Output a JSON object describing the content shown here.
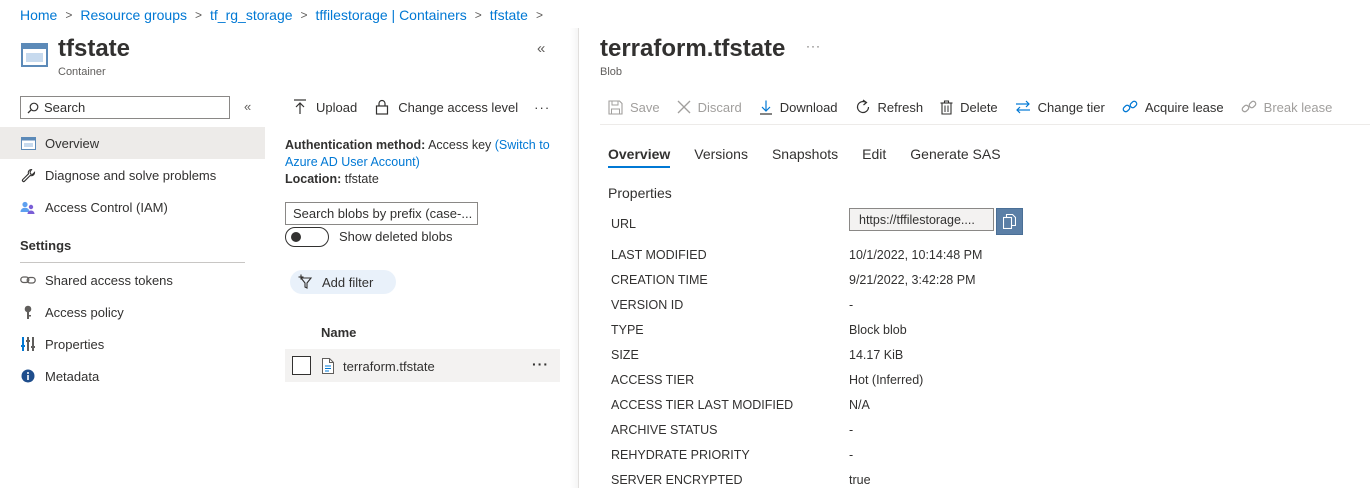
{
  "breadcrumb": [
    "Home",
    "Resource groups",
    "tf_rg_storage",
    "tffilestorage | Containers",
    "tfstate"
  ],
  "container": {
    "title": "tfstate",
    "subtitle": "Container"
  },
  "search": {
    "placeholder": "Search"
  },
  "nav": {
    "items": [
      {
        "label": "Overview",
        "icon": "container-icon",
        "active": true
      },
      {
        "label": "Diagnose and solve problems",
        "icon": "wrench-icon"
      },
      {
        "label": "Access Control (IAM)",
        "icon": "people-icon"
      }
    ],
    "settings_heading": "Settings",
    "settings_items": [
      {
        "label": "Shared access tokens",
        "icon": "link-icon"
      },
      {
        "label": "Access policy",
        "icon": "key-icon"
      },
      {
        "label": "Properties",
        "icon": "sliders-icon"
      },
      {
        "label": "Metadata",
        "icon": "info-icon"
      }
    ]
  },
  "middle": {
    "toolbar": {
      "upload": "Upload",
      "change_access": "Change access level",
      "more": "···"
    },
    "auth_label": "Authentication method:",
    "auth_value": "Access key",
    "auth_link": "(Switch to Azure AD User Account)",
    "location_label": "Location:",
    "location_value": "tfstate",
    "blob_search_placeholder": "Search blobs by prefix (case-...",
    "show_deleted": "Show deleted blobs",
    "add_filter": "Add filter",
    "column_name": "Name",
    "rows": [
      {
        "name": "terraform.tfstate"
      }
    ]
  },
  "blob": {
    "title": "terraform.tfstate",
    "subtitle": "Blob",
    "more": "···",
    "toolbar": {
      "save": "Save",
      "discard": "Discard",
      "download": "Download",
      "refresh": "Refresh",
      "delete": "Delete",
      "change_tier": "Change tier",
      "acquire_lease": "Acquire lease",
      "break_lease": "Break lease"
    },
    "tabs": [
      "Overview",
      "Versions",
      "Snapshots",
      "Edit",
      "Generate SAS"
    ],
    "properties_heading": "Properties",
    "url_label": "URL",
    "url_value": "https://tffilestorage....",
    "properties": [
      {
        "label": "LAST MODIFIED",
        "value": "10/1/2022, 10:14:48 PM"
      },
      {
        "label": "CREATION TIME",
        "value": "9/21/2022, 3:42:28 PM"
      },
      {
        "label": "VERSION ID",
        "value": "-"
      },
      {
        "label": "TYPE",
        "value": "Block blob"
      },
      {
        "label": "SIZE",
        "value": "14.17 KiB"
      },
      {
        "label": "ACCESS TIER",
        "value": "Hot (Inferred)"
      },
      {
        "label": "ACCESS TIER LAST MODIFIED",
        "value": "N/A"
      },
      {
        "label": "ARCHIVE STATUS",
        "value": "-"
      },
      {
        "label": "REHYDRATE PRIORITY",
        "value": "-"
      },
      {
        "label": "SERVER ENCRYPTED",
        "value": "true"
      }
    ]
  },
  "colors": {
    "accent": "#0078d4",
    "nav_active_bg": "#edebe9",
    "copy_button": "#5b7fa6",
    "disabled_text": "#a19f9d"
  }
}
